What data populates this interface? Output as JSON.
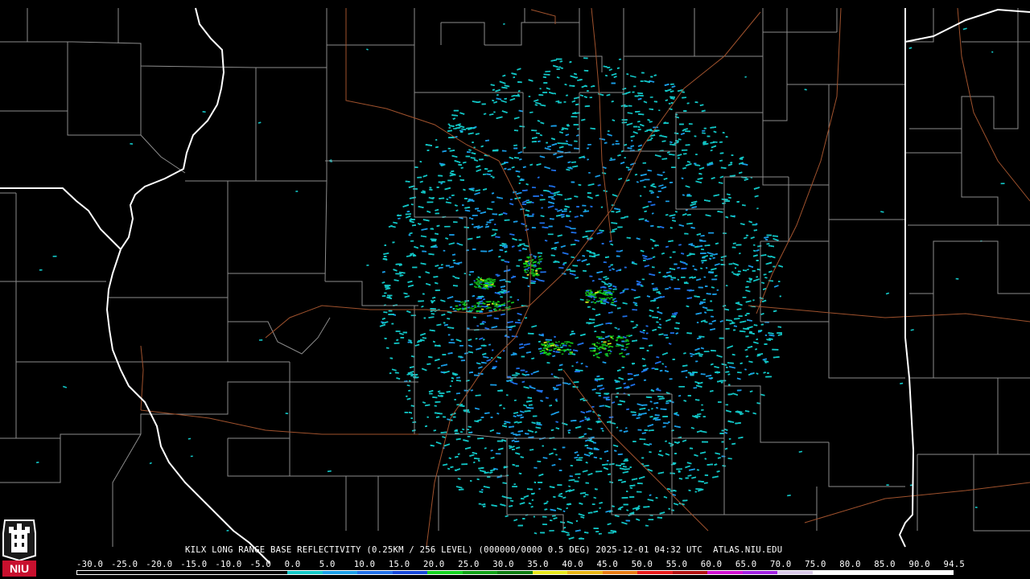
{
  "radar": {
    "site": "KILX",
    "product": "LONG RANGE BASE REFLECTIVITY",
    "caption": "KILX LONG RANGE BASE REFLECTIVITY (0.25KM / 256 LEVEL) (000000/0000 0.5 DEG) 2025-12-01 04:32 UTC  ATLAS.NIU.EDU"
  },
  "colorbar": {
    "labels": [
      "-30.0",
      "-25.0",
      "-20.0",
      "-15.0",
      "-10.0",
      "-5.0",
      "0.0",
      "5.0",
      "10.0",
      "15.0",
      "20.0",
      "25.0",
      "30.0",
      "35.0",
      "40.0",
      "45.0",
      "50.0",
      "55.0",
      "60.0",
      "65.0",
      "70.0",
      "75.0",
      "80.0",
      "85.0",
      "90.0",
      "94.5"
    ],
    "colors": [
      "#000000",
      "#000000",
      "#000000",
      "#000000",
      "#000000",
      "#000000",
      "#12c7c7",
      "#1a9ee8",
      "#1f6fe8",
      "#1445d8",
      "#12d21e",
      "#0ea014",
      "#0a7a0e",
      "#e8e81a",
      "#e8b412",
      "#e87a12",
      "#e81a1a",
      "#b01010",
      "#d010d0",
      "#a020e0",
      "#d8c8e8",
      "#ffffff",
      "#ffffff",
      "#ffffff",
      "#ffffff"
    ]
  },
  "map": {
    "colors": {
      "background": "#000000",
      "county_lines": "#8c8c8c",
      "state_lines": "#ffffff",
      "roads": "#a0522d"
    }
  },
  "logo": {
    "text": "NIU",
    "color": "#c8102e"
  }
}
